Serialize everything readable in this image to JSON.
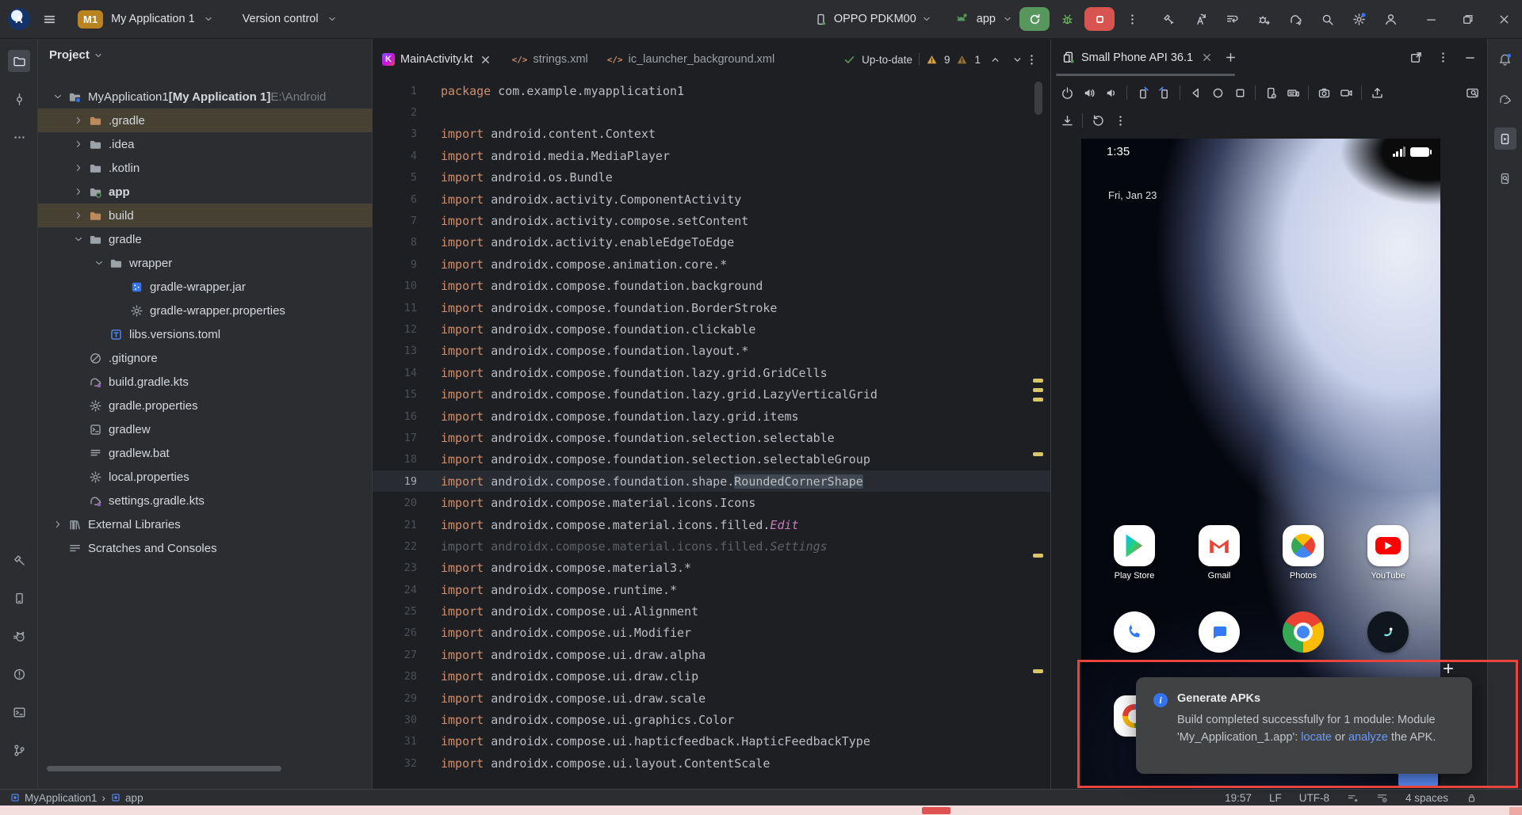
{
  "titlebar": {
    "badge": "M1",
    "project_name": "My Application 1",
    "vcs_label": "Version control",
    "device_name": "OPPO PDKM00",
    "run_config": "app",
    "actions": [
      "build-run",
      "apply-changes",
      "apply-code",
      "attach-debugger",
      "gradle-sync",
      "search-everywhere",
      "settings",
      "account"
    ],
    "window": [
      "minimize",
      "maximize",
      "close"
    ]
  },
  "left_bar": {
    "top": [
      "project",
      "commit",
      "more"
    ],
    "bottom": [
      "build",
      "device-manager",
      "logcat",
      "problems",
      "terminal",
      "version-control"
    ],
    "active": "project"
  },
  "right_bar": {
    "items": [
      "notifications",
      "gradle",
      "running-devices",
      "device-explorer"
    ],
    "active": "running-devices"
  },
  "project_panel": {
    "header": "Project",
    "tree": [
      {
        "label": "MyApplication1",
        "suffix": " [My Application 1]",
        "path": " E:\\Android",
        "level": 0,
        "chevron": "down",
        "icon": "module-folder"
      },
      {
        "label": ".gradle",
        "level": 1,
        "chevron": "right",
        "icon": "folder-orange",
        "highlight": true
      },
      {
        "label": ".idea",
        "level": 1,
        "chevron": "right",
        "icon": "folder"
      },
      {
        "label": ".kotlin",
        "level": 1,
        "chevron": "right",
        "icon": "folder"
      },
      {
        "label": "app",
        "level": 1,
        "chevron": "right",
        "icon": "folder-app",
        "bold": true
      },
      {
        "label": "build",
        "level": 1,
        "chevron": "right",
        "icon": "folder-orange",
        "highlight": true
      },
      {
        "label": "gradle",
        "level": 1,
        "chevron": "down",
        "icon": "folder"
      },
      {
        "label": "wrapper",
        "level": 2,
        "chevron": "down",
        "icon": "folder"
      },
      {
        "label": "gradle-wrapper.jar",
        "level": 3,
        "icon": "jar"
      },
      {
        "label": "gradle-wrapper.properties",
        "level": 3,
        "icon": "gear-file"
      },
      {
        "label": "libs.versions.toml",
        "level": 2,
        "icon": "toml"
      },
      {
        "label": ".gitignore",
        "level": 1,
        "icon": "gitignore"
      },
      {
        "label": "build.gradle.kts",
        "level": 1,
        "icon": "gradle-file"
      },
      {
        "label": "gradle.properties",
        "level": 1,
        "icon": "gear-file"
      },
      {
        "label": "gradlew",
        "level": 1,
        "icon": "terminal-file"
      },
      {
        "label": "gradlew.bat",
        "level": 1,
        "icon": "text-file"
      },
      {
        "label": "local.properties",
        "level": 1,
        "icon": "gear-file"
      },
      {
        "label": "settings.gradle.kts",
        "level": 1,
        "icon": "gradle-file"
      },
      {
        "label": "External Libraries",
        "level": 0,
        "chevron": "right",
        "icon": "library"
      },
      {
        "label": "Scratches and Consoles",
        "level": 0,
        "icon": "scratches"
      }
    ]
  },
  "editor": {
    "tabs": [
      {
        "label": "MainActivity.kt",
        "icon": "kotlin",
        "active": true,
        "close": true
      },
      {
        "label": "strings.xml",
        "icon": "xml"
      },
      {
        "label": "ic_launcher_background.xml",
        "icon": "xml"
      }
    ],
    "view_toggles": [
      "list-view",
      "split-view",
      "design-view"
    ],
    "inspection": {
      "status": "Up-to-date",
      "warnings": "9",
      "weak_warnings": "1"
    },
    "lines": [
      {
        "n": "1",
        "kw": "package",
        "body": " com.example.myapplication1"
      },
      {
        "n": "2",
        "body": ""
      },
      {
        "n": "3",
        "kw": "import",
        "body": " android.content.Context"
      },
      {
        "n": "4",
        "kw": "import",
        "body": " android.media.MediaPlayer"
      },
      {
        "n": "5",
        "kw": "import",
        "body": " android.os.Bundle"
      },
      {
        "n": "6",
        "kw": "import",
        "body": " androidx.activity.ComponentActivity"
      },
      {
        "n": "7",
        "kw": "import",
        "body": " androidx.activity.compose.setContent"
      },
      {
        "n": "8",
        "kw": "import",
        "body": " androidx.activity.enableEdgeToEdge"
      },
      {
        "n": "9",
        "kw": "import",
        "body": " androidx.compose.animation.core.*"
      },
      {
        "n": "10",
        "kw": "import",
        "body": " androidx.compose.foundation.background"
      },
      {
        "n": "11",
        "kw": "import",
        "body": " androidx.compose.foundation.BorderStroke"
      },
      {
        "n": "12",
        "kw": "import",
        "body": " androidx.compose.foundation.clickable"
      },
      {
        "n": "13",
        "kw": "import",
        "body": " androidx.compose.foundation.layout.*"
      },
      {
        "n": "14",
        "kw": "import",
        "body": " androidx.compose.foundation.lazy.grid.GridCells"
      },
      {
        "n": "15",
        "kw": "import",
        "body": " androidx.compose.foundation.lazy.grid.LazyVerticalGrid"
      },
      {
        "n": "16",
        "kw": "import",
        "body": " androidx.compose.foundation.lazy.grid.items"
      },
      {
        "n": "17",
        "kw": "import",
        "body": " androidx.compose.foundation.selection.selectable"
      },
      {
        "n": "18",
        "kw": "import",
        "body": " androidx.compose.foundation.selection.selectableGroup"
      },
      {
        "n": "19",
        "kw": "import",
        "body": " androidx.compose.foundation.shape.",
        "hl": "RoundedCornerShape",
        "current": true
      },
      {
        "n": "20",
        "kw": "import",
        "body": " androidx.compose.material.icons.Icons"
      },
      {
        "n": "21",
        "kw": "import",
        "body": " androidx.compose.material.icons.filled.",
        "em": "Edit"
      },
      {
        "n": "22",
        "kw": "import",
        "body": " androidx.compose.material.icons.filled.",
        "em": "Settings",
        "dim": true
      },
      {
        "n": "23",
        "kw": "import",
        "body": " androidx.compose.material3.*"
      },
      {
        "n": "24",
        "kw": "import",
        "body": " androidx.compose.runtime.*"
      },
      {
        "n": "25",
        "kw": "import",
        "body": " androidx.compose.ui.Alignment"
      },
      {
        "n": "26",
        "kw": "import",
        "body": " androidx.compose.ui.Modifier"
      },
      {
        "n": "27",
        "kw": "import",
        "body": " androidx.compose.ui.draw.alpha"
      },
      {
        "n": "28",
        "kw": "import",
        "body": " androidx.compose.ui.draw.clip"
      },
      {
        "n": "29",
        "kw": "import",
        "body": " androidx.compose.ui.draw.scale"
      },
      {
        "n": "30",
        "kw": "import",
        "body": " androidx.compose.ui.graphics.Color"
      },
      {
        "n": "31",
        "kw": "import",
        "body": " androidx.compose.ui.hapticfeedback.HapticFeedbackType"
      },
      {
        "n": "32",
        "kw": "import",
        "body": " androidx.compose.ui.layout.ContentScale"
      }
    ]
  },
  "device_panel": {
    "tab_label": "Small Phone API 36.1",
    "toolbar_row1": [
      "power",
      "volume-up",
      "volume-down",
      "|",
      "rotate-left",
      "rotate-right",
      "|",
      "back",
      "home",
      "overview",
      "|",
      "device-settings",
      "hardware-input",
      "|",
      "screenshot",
      "screen-record",
      "|",
      "upload"
    ],
    "toolbar_row1_right": [
      "zoom"
    ],
    "toolbar_row2": [
      "download",
      "reset",
      "more-kebab"
    ],
    "emulator": {
      "time": "1:35",
      "date": "Fri, Jan 23",
      "status_icons": [
        "signal-bars",
        "battery"
      ],
      "app_rows": [
        [
          {
            "icon": "play-store",
            "label": "Play Store"
          },
          {
            "icon": "gmail",
            "label": "Gmail"
          },
          {
            "icon": "photos",
            "label": "Photos"
          },
          {
            "icon": "youtube",
            "label": "YouTube"
          }
        ],
        [
          {
            "icon": "phone-app"
          },
          {
            "icon": "messages-app"
          },
          {
            "icon": "chrome-app"
          },
          {
            "icon": "dark-swirl-app"
          }
        ],
        [
          {
            "icon": "google-g-app"
          }
        ]
      ]
    },
    "notification": {
      "title": "Generate APKs",
      "body_parts": [
        {
          "text": "Build completed successfully for 1 module: Module 'My_Application_1.app': "
        },
        {
          "link": "locate"
        },
        {
          "text": " or "
        },
        {
          "link": "analyze"
        },
        {
          "text": " the APK."
        }
      ]
    }
  },
  "status_bar": {
    "crumbs": [
      {
        "label": "MyApplication1"
      },
      {
        "label": "app"
      }
    ],
    "separator": "›",
    "items": [
      {
        "t": "19:57"
      },
      {
        "t": "LF"
      },
      {
        "t": "UTF-8"
      },
      {
        "i": "line-separator"
      },
      {
        "i": "indent-settings"
      },
      {
        "t": "4 spaces"
      },
      {
        "i": "readonly"
      }
    ]
  },
  "colors": {
    "accent": "#3574f0",
    "run_green": "#57965c",
    "stop_red": "#d75450",
    "warning_yellow": "#d9a444",
    "annotation_red": "#e8463c",
    "link_blue": "#6a9bfa"
  }
}
